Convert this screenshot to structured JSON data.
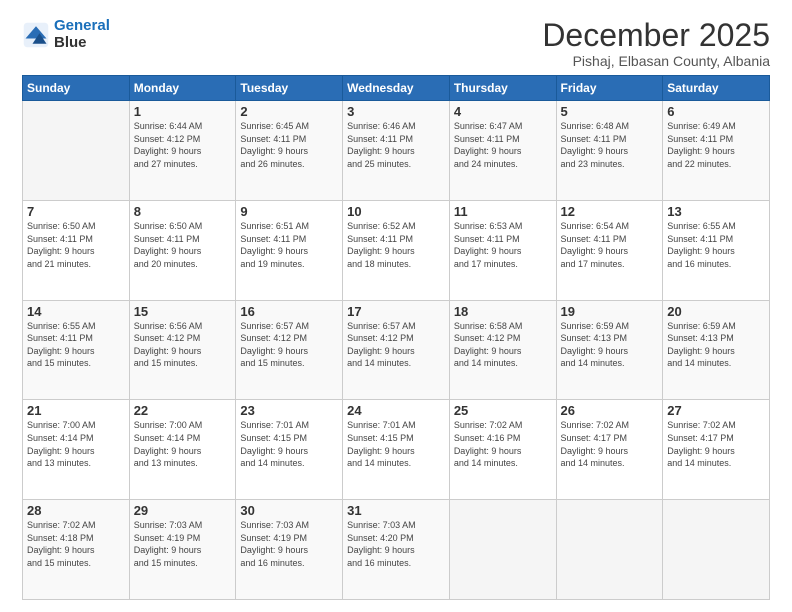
{
  "logo": {
    "line1": "General",
    "line2": "Blue"
  },
  "header": {
    "title": "December 2025",
    "subtitle": "Pishaj, Elbasan County, Albania"
  },
  "weekdays": [
    "Sunday",
    "Monday",
    "Tuesday",
    "Wednesday",
    "Thursday",
    "Friday",
    "Saturday"
  ],
  "weeks": [
    [
      {
        "day": "",
        "info": ""
      },
      {
        "day": "1",
        "info": "Sunrise: 6:44 AM\nSunset: 4:12 PM\nDaylight: 9 hours\nand 27 minutes."
      },
      {
        "day": "2",
        "info": "Sunrise: 6:45 AM\nSunset: 4:11 PM\nDaylight: 9 hours\nand 26 minutes."
      },
      {
        "day": "3",
        "info": "Sunrise: 6:46 AM\nSunset: 4:11 PM\nDaylight: 9 hours\nand 25 minutes."
      },
      {
        "day": "4",
        "info": "Sunrise: 6:47 AM\nSunset: 4:11 PM\nDaylight: 9 hours\nand 24 minutes."
      },
      {
        "day": "5",
        "info": "Sunrise: 6:48 AM\nSunset: 4:11 PM\nDaylight: 9 hours\nand 23 minutes."
      },
      {
        "day": "6",
        "info": "Sunrise: 6:49 AM\nSunset: 4:11 PM\nDaylight: 9 hours\nand 22 minutes."
      }
    ],
    [
      {
        "day": "7",
        "info": "Sunrise: 6:50 AM\nSunset: 4:11 PM\nDaylight: 9 hours\nand 21 minutes."
      },
      {
        "day": "8",
        "info": "Sunrise: 6:50 AM\nSunset: 4:11 PM\nDaylight: 9 hours\nand 20 minutes."
      },
      {
        "day": "9",
        "info": "Sunrise: 6:51 AM\nSunset: 4:11 PM\nDaylight: 9 hours\nand 19 minutes."
      },
      {
        "day": "10",
        "info": "Sunrise: 6:52 AM\nSunset: 4:11 PM\nDaylight: 9 hours\nand 18 minutes."
      },
      {
        "day": "11",
        "info": "Sunrise: 6:53 AM\nSunset: 4:11 PM\nDaylight: 9 hours\nand 17 minutes."
      },
      {
        "day": "12",
        "info": "Sunrise: 6:54 AM\nSunset: 4:11 PM\nDaylight: 9 hours\nand 17 minutes."
      },
      {
        "day": "13",
        "info": "Sunrise: 6:55 AM\nSunset: 4:11 PM\nDaylight: 9 hours\nand 16 minutes."
      }
    ],
    [
      {
        "day": "14",
        "info": "Sunrise: 6:55 AM\nSunset: 4:11 PM\nDaylight: 9 hours\nand 15 minutes."
      },
      {
        "day": "15",
        "info": "Sunrise: 6:56 AM\nSunset: 4:12 PM\nDaylight: 9 hours\nand 15 minutes."
      },
      {
        "day": "16",
        "info": "Sunrise: 6:57 AM\nSunset: 4:12 PM\nDaylight: 9 hours\nand 15 minutes."
      },
      {
        "day": "17",
        "info": "Sunrise: 6:57 AM\nSunset: 4:12 PM\nDaylight: 9 hours\nand 14 minutes."
      },
      {
        "day": "18",
        "info": "Sunrise: 6:58 AM\nSunset: 4:12 PM\nDaylight: 9 hours\nand 14 minutes."
      },
      {
        "day": "19",
        "info": "Sunrise: 6:59 AM\nSunset: 4:13 PM\nDaylight: 9 hours\nand 14 minutes."
      },
      {
        "day": "20",
        "info": "Sunrise: 6:59 AM\nSunset: 4:13 PM\nDaylight: 9 hours\nand 14 minutes."
      }
    ],
    [
      {
        "day": "21",
        "info": "Sunrise: 7:00 AM\nSunset: 4:14 PM\nDaylight: 9 hours\nand 13 minutes."
      },
      {
        "day": "22",
        "info": "Sunrise: 7:00 AM\nSunset: 4:14 PM\nDaylight: 9 hours\nand 13 minutes."
      },
      {
        "day": "23",
        "info": "Sunrise: 7:01 AM\nSunset: 4:15 PM\nDaylight: 9 hours\nand 14 minutes."
      },
      {
        "day": "24",
        "info": "Sunrise: 7:01 AM\nSunset: 4:15 PM\nDaylight: 9 hours\nand 14 minutes."
      },
      {
        "day": "25",
        "info": "Sunrise: 7:02 AM\nSunset: 4:16 PM\nDaylight: 9 hours\nand 14 minutes."
      },
      {
        "day": "26",
        "info": "Sunrise: 7:02 AM\nSunset: 4:17 PM\nDaylight: 9 hours\nand 14 minutes."
      },
      {
        "day": "27",
        "info": "Sunrise: 7:02 AM\nSunset: 4:17 PM\nDaylight: 9 hours\nand 14 minutes."
      }
    ],
    [
      {
        "day": "28",
        "info": "Sunrise: 7:02 AM\nSunset: 4:18 PM\nDaylight: 9 hours\nand 15 minutes."
      },
      {
        "day": "29",
        "info": "Sunrise: 7:03 AM\nSunset: 4:19 PM\nDaylight: 9 hours\nand 15 minutes."
      },
      {
        "day": "30",
        "info": "Sunrise: 7:03 AM\nSunset: 4:19 PM\nDaylight: 9 hours\nand 16 minutes."
      },
      {
        "day": "31",
        "info": "Sunrise: 7:03 AM\nSunset: 4:20 PM\nDaylight: 9 hours\nand 16 minutes."
      },
      {
        "day": "",
        "info": ""
      },
      {
        "day": "",
        "info": ""
      },
      {
        "day": "",
        "info": ""
      }
    ]
  ]
}
